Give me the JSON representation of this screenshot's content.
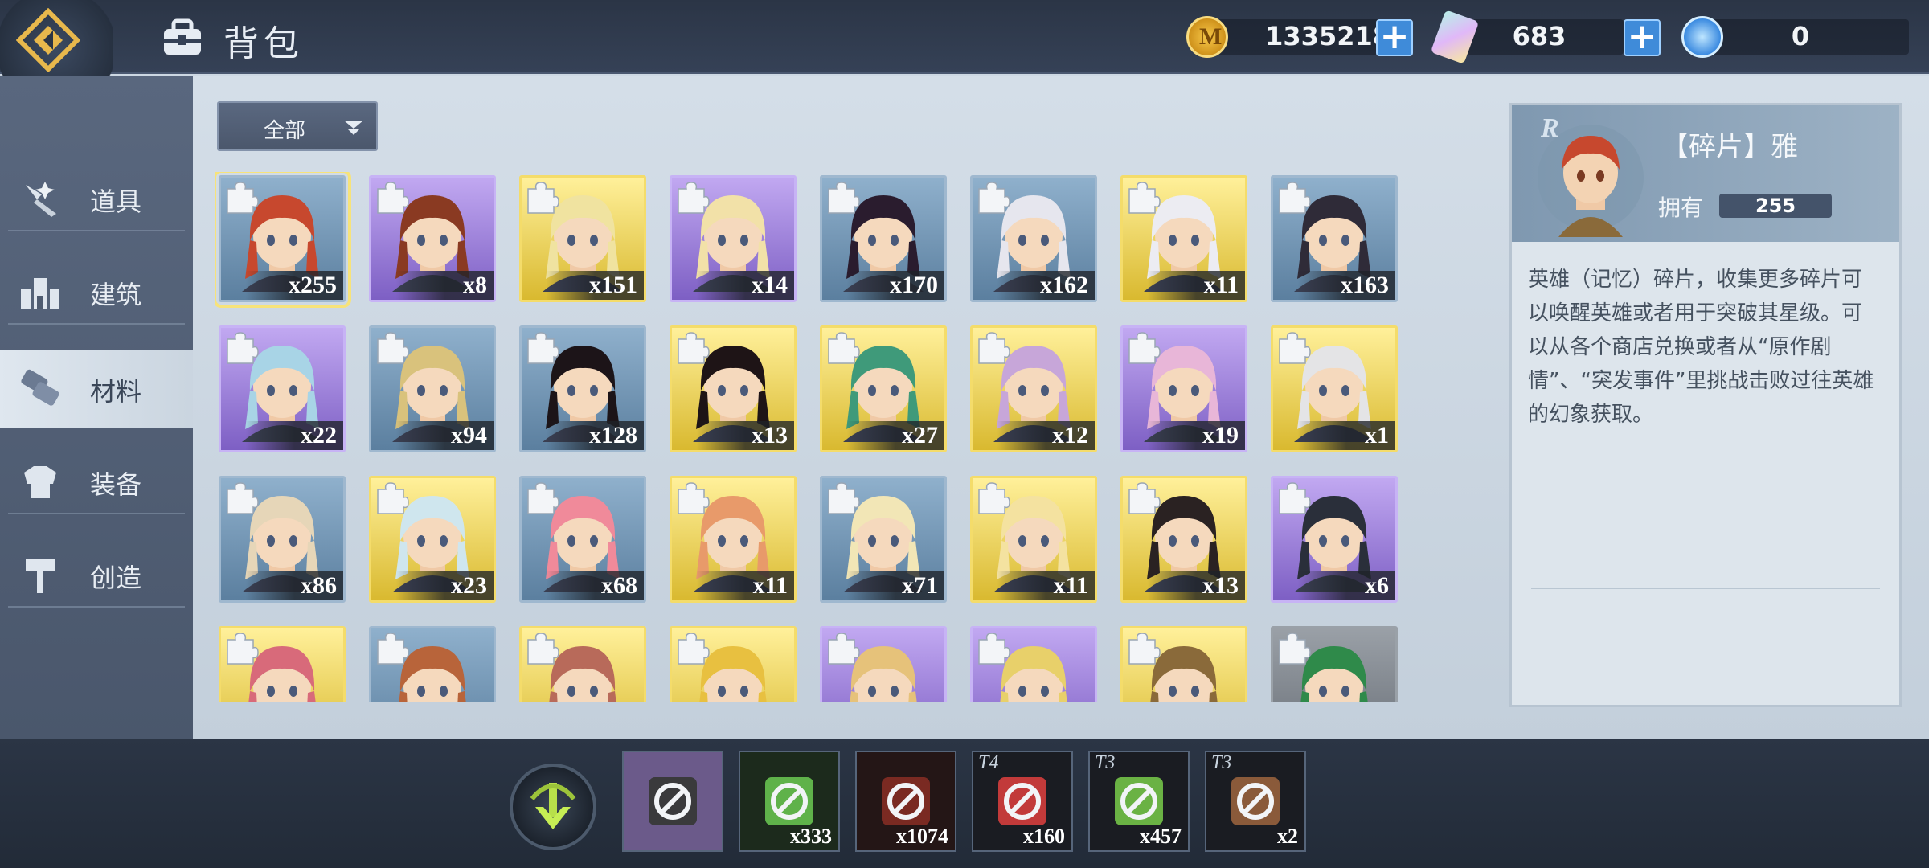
{
  "header": {
    "title": "背包",
    "currencies": [
      {
        "name": "gold-coin-icon",
        "value": "1335218"
      },
      {
        "name": "gem-icon",
        "value": "683"
      },
      {
        "name": "blue-orb-icon",
        "value": "0"
      }
    ]
  },
  "sidebar": {
    "items": [
      {
        "label": "道具",
        "icon": "sparkle-tool-icon"
      },
      {
        "label": "建筑",
        "icon": "building-icon"
      },
      {
        "label": "材料",
        "icon": "materials-icon",
        "active": true
      },
      {
        "label": "装备",
        "icon": "armor-icon"
      },
      {
        "label": "创造",
        "icon": "hammer-icon"
      }
    ]
  },
  "filter": {
    "label": "全部"
  },
  "fragments": [
    {
      "qty": "x255",
      "rarity": "blue",
      "hair": "#c7482e",
      "selected": true
    },
    {
      "qty": "x8",
      "rarity": "purple",
      "hair": "#8a3a22"
    },
    {
      "qty": "x151",
      "rarity": "gold",
      "hair": "#f0e3a0"
    },
    {
      "qty": "x14",
      "rarity": "purple",
      "hair": "#f2e1a8"
    },
    {
      "qty": "x170",
      "rarity": "blue",
      "hair": "#2a1c2e"
    },
    {
      "qty": "x162",
      "rarity": "blue",
      "hair": "#e6e6ee"
    },
    {
      "qty": "x11",
      "rarity": "gold",
      "hair": "#ececf2"
    },
    {
      "qty": "x163",
      "rarity": "blue",
      "hair": "#2f2b38"
    },
    {
      "qty": "x22",
      "rarity": "purple",
      "hair": "#a8d4e6"
    },
    {
      "qty": "x94",
      "rarity": "blue",
      "hair": "#d9c27c"
    },
    {
      "qty": "x128",
      "rarity": "blue",
      "hair": "#1c1418"
    },
    {
      "qty": "x13",
      "rarity": "gold",
      "hair": "#1e1416"
    },
    {
      "qty": "x27",
      "rarity": "gold",
      "hair": "#3f9a7a"
    },
    {
      "qty": "x12",
      "rarity": "gold",
      "hair": "#c7a6d9"
    },
    {
      "qty": "x19",
      "rarity": "purple",
      "hair": "#e8b6d8"
    },
    {
      "qty": "x1",
      "rarity": "gold",
      "hair": "#e4e4e6"
    },
    {
      "qty": "x86",
      "rarity": "blue",
      "hair": "#e6d6b8"
    },
    {
      "qty": "x23",
      "rarity": "gold",
      "hair": "#cfe6ee"
    },
    {
      "qty": "x68",
      "rarity": "blue",
      "hair": "#f08a9a"
    },
    {
      "qty": "x11",
      "rarity": "gold",
      "hair": "#e89a6a"
    },
    {
      "qty": "x71",
      "rarity": "blue",
      "hair": "#f2e6b6"
    },
    {
      "qty": "x11",
      "rarity": "gold",
      "hair": "#f4e2a0"
    },
    {
      "qty": "x13",
      "rarity": "gold",
      "hair": "#2a2222"
    },
    {
      "qty": "x6",
      "rarity": "purple",
      "hair": "#2a2f3a"
    },
    {
      "qty": "",
      "rarity": "gold",
      "hair": "#d86a7a"
    },
    {
      "qty": "",
      "rarity": "blue",
      "hair": "#b8643a"
    },
    {
      "qty": "",
      "rarity": "gold",
      "hair": "#b86a5a"
    },
    {
      "qty": "",
      "rarity": "gold",
      "hair": "#e8c040"
    },
    {
      "qty": "",
      "rarity": "purple",
      "hair": "#e6c27a"
    },
    {
      "qty": "",
      "rarity": "purple",
      "hair": "#e8d06a"
    },
    {
      "qty": "",
      "rarity": "gold",
      "hair": "#8a6a3a"
    },
    {
      "qty": "",
      "rarity": "gray",
      "hair": "#2f8a4a"
    }
  ],
  "detail": {
    "rank": "R",
    "name": "【碎片】雅",
    "own_label": "拥有",
    "own_value": "255",
    "description": "英雄（记忆）碎片，收集更多碎片可以唤醒英雄或者用于突破其星级。可以从各个商店兑换或者从“原作剧情”、“突发事件”里挑战击败过往英雄的幻象获取。"
  },
  "bottom_slots": [
    {
      "tier": "",
      "qty": "",
      "color": "#3a3a3c",
      "bg": "#6b5a8a"
    },
    {
      "tier": "",
      "qty": "x333",
      "color": "#5fb24a",
      "bg": "#1c2a1c"
    },
    {
      "tier": "",
      "qty": "x1074",
      "color": "#7a2a22",
      "bg": "#241616"
    },
    {
      "tier": "T4",
      "qty": "x160",
      "color": "#c23a3a",
      "bg": "#1a1c22"
    },
    {
      "tier": "T3",
      "qty": "x457",
      "color": "#6ab244",
      "bg": "#1a1c22"
    },
    {
      "tier": "T3",
      "qty": "x2",
      "color": "#8a5a3a",
      "bg": "#1a1c22"
    }
  ]
}
